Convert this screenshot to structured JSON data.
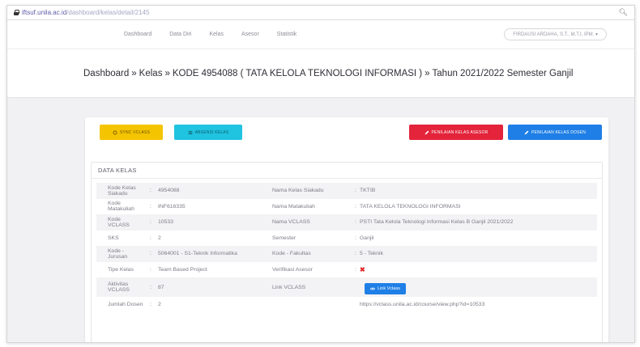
{
  "browser": {
    "url_host": "iftsuf.unila.ac.id",
    "url_path": "/dashboard/kelas/detail/2145",
    "zoom_icon": "magnifier-icon"
  },
  "nav": {
    "items": [
      "Dashboard",
      "Data Diri",
      "Kelas",
      "Asesor",
      "Statistik"
    ],
    "user": "FIRDAUSI ARDAHA, S.T., M.T.I, IPM."
  },
  "breadcrumb": {
    "root": "Dashboard",
    "sep": "»",
    "level1": "Kelas",
    "level2": "KODE 4954088 ( TATA KELOLA TEKNOLOGI INFORMASI )",
    "level3": "Tahun 2021/2022 Semester Ganjil"
  },
  "buttons": {
    "sync": "SYNC VCLASS",
    "absen": "ABSENSI KELAS",
    "nilai_asesor": "PENILAIAN KELAS ASESOR",
    "nilai_dosen": "PENILAIAN KELAS DOSEN"
  },
  "panel": {
    "title": "DATA KELAS",
    "sep": ":",
    "rows": [
      {
        "l_label": "Kode Kelas Siakadu",
        "l_value": "4954088",
        "r_label": "Nama Kelas Siakadu",
        "r_value": "TKTIB"
      },
      {
        "l_label": "Kode Matakuliah",
        "l_value": "INF616335",
        "r_label": "Nama Matakuliah",
        "r_value": "TATA KELOLA TEKNOLOGI INFORMASI"
      },
      {
        "l_label": "Kode VCLASS",
        "l_value": "10533",
        "r_label": "Nama VCLASS",
        "r_value": "PSTI Tata Kelola Teknologi Informasi Kelas B Ganjil 2021/2022"
      },
      {
        "l_label": "SKS",
        "l_value": "2",
        "r_label": "Semester",
        "r_value": "Ganjil"
      },
      {
        "l_label": "Kode - Jurusan",
        "l_value": "5064001 - S1-Teknik Informatika",
        "r_label": "Kode - Fakultas",
        "r_value": "5 - Teknik"
      },
      {
        "l_label": "Tipe Kelas",
        "l_value": "Team Based Project",
        "r_label": "Verifikasi Asesor",
        "r_value": "✖"
      },
      {
        "l_label": "Aktivitas VCLASS",
        "l_value": "87",
        "r_label": "Link VCLASS",
        "r_value": "Link Vclass"
      },
      {
        "l_label": "Jumlah Dosen",
        "l_value": "2",
        "r_label": "",
        "r_value": "https://vclass.unila.ac.id/course/view.php?id=10533"
      }
    ]
  },
  "colors": {
    "yellow": "#f5c400",
    "cyan": "#20c3e0",
    "red": "#e3243b",
    "blue": "#1f7fe6"
  }
}
